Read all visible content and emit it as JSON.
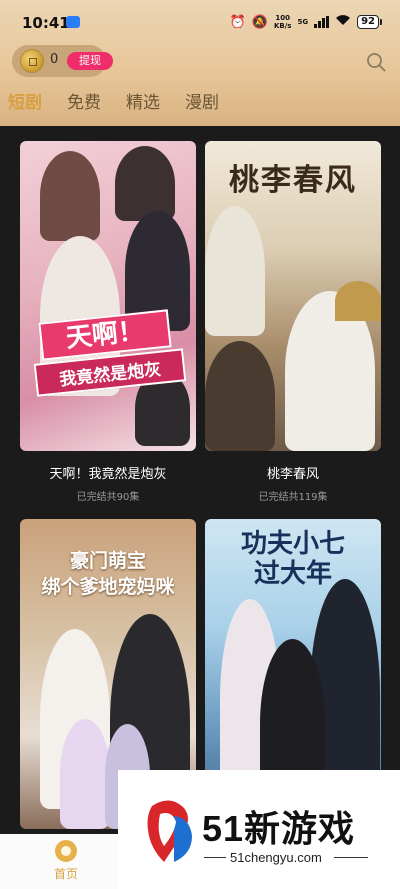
{
  "status_bar": {
    "time": "10:41",
    "speed_value": "100",
    "speed_unit": "KB/s",
    "network": "5G",
    "battery": "92"
  },
  "header": {
    "coin_count": "0",
    "withdraw_label": "提现",
    "tabs": [
      {
        "label": "短剧",
        "active": true
      },
      {
        "label": "免费",
        "active": false
      },
      {
        "label": "精选",
        "active": false
      },
      {
        "label": "漫剧",
        "active": false
      }
    ]
  },
  "dramas": [
    {
      "title": "天啊！我竟然是炮灰",
      "episodes": "已完结共90集",
      "poster_line1": "天啊！",
      "poster_line2": "我竟然是炮灰"
    },
    {
      "title": "桃李春风",
      "episodes": "已完结共119集",
      "poster_line1": "桃李春风"
    },
    {
      "poster_line1": "豪门萌宝",
      "poster_line2": "绑个爹地宠妈咪"
    },
    {
      "poster_line1": "功夫小七",
      "poster_line2": "过大年"
    }
  ],
  "bottom_nav": {
    "home_label": "首页"
  },
  "watermark": {
    "brand": "51新游戏",
    "domain": "51chengyu.com"
  },
  "colors": {
    "header_gradient_top": "#ecd6b4",
    "active_tab": "#d7a040",
    "withdraw_button": "#ee2d6a",
    "background": "#1b1b1b"
  }
}
